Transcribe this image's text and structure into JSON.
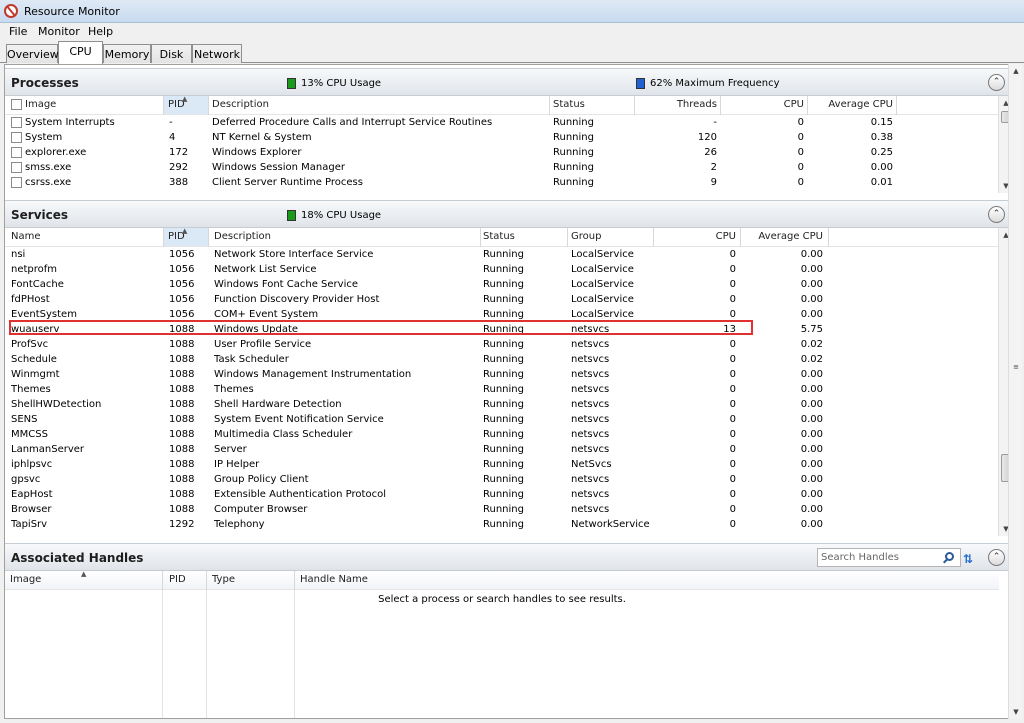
{
  "window": {
    "title": "Resource Monitor"
  },
  "menu": {
    "file": "File",
    "monitor": "Monitor",
    "help": "Help"
  },
  "tabs": [
    "Overview",
    "CPU",
    "Memory",
    "Disk",
    "Network"
  ],
  "colors": {
    "cpu_legend": "#1a9a1a",
    "freq_legend": "#2060d0",
    "highlight": "#e03030",
    "accent": "#2a6fc9"
  },
  "processes": {
    "title": "Processes",
    "cpu_usage": "13% CPU Usage",
    "max_frequency": "62% Maximum Frequency",
    "columns": {
      "image": "Image",
      "pid": "PID",
      "description": "Description",
      "status": "Status",
      "threads": "Threads",
      "cpu": "CPU",
      "avg_cpu": "Average CPU"
    },
    "rows": [
      {
        "image": "System Interrupts",
        "pid": "-",
        "description": "Deferred Procedure Calls and Interrupt Service Routines",
        "status": "Running",
        "threads": "-",
        "cpu": "0",
        "avg_cpu": "0.15"
      },
      {
        "image": "System",
        "pid": "4",
        "description": "NT Kernel & System",
        "status": "Running",
        "threads": "120",
        "cpu": "0",
        "avg_cpu": "0.38"
      },
      {
        "image": "explorer.exe",
        "pid": "172",
        "description": "Windows Explorer",
        "status": "Running",
        "threads": "26",
        "cpu": "0",
        "avg_cpu": "0.25"
      },
      {
        "image": "smss.exe",
        "pid": "292",
        "description": "Windows Session Manager",
        "status": "Running",
        "threads": "2",
        "cpu": "0",
        "avg_cpu": "0.00"
      },
      {
        "image": "csrss.exe",
        "pid": "388",
        "description": "Client Server Runtime Process",
        "status": "Running",
        "threads": "9",
        "cpu": "0",
        "avg_cpu": "0.01"
      }
    ]
  },
  "services": {
    "title": "Services",
    "cpu_usage": "18% CPU Usage",
    "columns": {
      "name": "Name",
      "pid": "PID",
      "description": "Description",
      "status": "Status",
      "group": "Group",
      "cpu": "CPU",
      "avg_cpu": "Average CPU"
    },
    "rows": [
      {
        "name": "nsi",
        "pid": "1056",
        "description": "Network Store Interface Service",
        "status": "Running",
        "group": "LocalService",
        "cpu": "0",
        "avg_cpu": "0.00"
      },
      {
        "name": "netprofm",
        "pid": "1056",
        "description": "Network List Service",
        "status": "Running",
        "group": "LocalService",
        "cpu": "0",
        "avg_cpu": "0.00"
      },
      {
        "name": "FontCache",
        "pid": "1056",
        "description": "Windows Font Cache Service",
        "status": "Running",
        "group": "LocalService",
        "cpu": "0",
        "avg_cpu": "0.00"
      },
      {
        "name": "fdPHost",
        "pid": "1056",
        "description": "Function Discovery Provider Host",
        "status": "Running",
        "group": "LocalService",
        "cpu": "0",
        "avg_cpu": "0.00"
      },
      {
        "name": "EventSystem",
        "pid": "1056",
        "description": "COM+ Event System",
        "status": "Running",
        "group": "LocalService",
        "cpu": "0",
        "avg_cpu": "0.00"
      },
      {
        "name": "wuauserv",
        "pid": "1088",
        "description": "Windows Update",
        "status": "Running",
        "group": "netsvcs",
        "cpu": "13",
        "avg_cpu": "5.75"
      },
      {
        "name": "ProfSvc",
        "pid": "1088",
        "description": "User Profile Service",
        "status": "Running",
        "group": "netsvcs",
        "cpu": "0",
        "avg_cpu": "0.02"
      },
      {
        "name": "Schedule",
        "pid": "1088",
        "description": "Task Scheduler",
        "status": "Running",
        "group": "netsvcs",
        "cpu": "0",
        "avg_cpu": "0.02"
      },
      {
        "name": "Winmgmt",
        "pid": "1088",
        "description": "Windows Management Instrumentation",
        "status": "Running",
        "group": "netsvcs",
        "cpu": "0",
        "avg_cpu": "0.00"
      },
      {
        "name": "Themes",
        "pid": "1088",
        "description": "Themes",
        "status": "Running",
        "group": "netsvcs",
        "cpu": "0",
        "avg_cpu": "0.00"
      },
      {
        "name": "ShellHWDetection",
        "pid": "1088",
        "description": "Shell Hardware Detection",
        "status": "Running",
        "group": "netsvcs",
        "cpu": "0",
        "avg_cpu": "0.00"
      },
      {
        "name": "SENS",
        "pid": "1088",
        "description": "System Event Notification Service",
        "status": "Running",
        "group": "netsvcs",
        "cpu": "0",
        "avg_cpu": "0.00"
      },
      {
        "name": "MMCSS",
        "pid": "1088",
        "description": "Multimedia Class Scheduler",
        "status": "Running",
        "group": "netsvcs",
        "cpu": "0",
        "avg_cpu": "0.00"
      },
      {
        "name": "LanmanServer",
        "pid": "1088",
        "description": "Server",
        "status": "Running",
        "group": "netsvcs",
        "cpu": "0",
        "avg_cpu": "0.00"
      },
      {
        "name": "iphlpsvc",
        "pid": "1088",
        "description": "IP Helper",
        "status": "Running",
        "group": "NetSvcs",
        "cpu": "0",
        "avg_cpu": "0.00"
      },
      {
        "name": "gpsvc",
        "pid": "1088",
        "description": "Group Policy Client",
        "status": "Running",
        "group": "netsvcs",
        "cpu": "0",
        "avg_cpu": "0.00"
      },
      {
        "name": "EapHost",
        "pid": "1088",
        "description": "Extensible Authentication Protocol",
        "status": "Running",
        "group": "netsvcs",
        "cpu": "0",
        "avg_cpu": "0.00"
      },
      {
        "name": "Browser",
        "pid": "1088",
        "description": "Computer Browser",
        "status": "Running",
        "group": "netsvcs",
        "cpu": "0",
        "avg_cpu": "0.00"
      },
      {
        "name": "TapiSrv",
        "pid": "1292",
        "description": "Telephony",
        "status": "Running",
        "group": "NetworkService",
        "cpu": "0",
        "avg_cpu": "0.00"
      }
    ]
  },
  "handles": {
    "title": "Associated Handles",
    "search_placeholder": "Search Handles",
    "columns": {
      "image": "Image",
      "pid": "PID",
      "type": "Type",
      "handle_name": "Handle Name"
    },
    "hint": "Select a process or search handles to see results."
  }
}
